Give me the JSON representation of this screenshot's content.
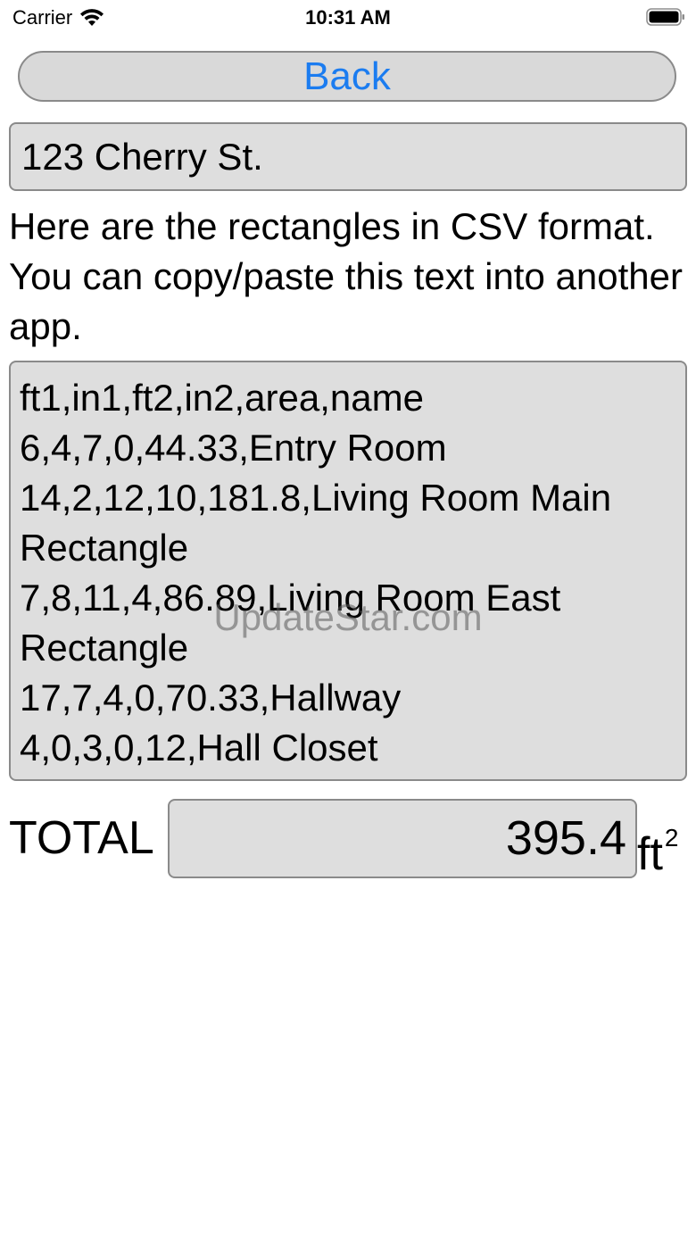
{
  "status_bar": {
    "carrier": "Carrier",
    "time": "10:31 AM",
    "wifi_icon": "wifi-icon",
    "battery_icon": "battery-icon"
  },
  "back_button": {
    "label": "Back",
    "color": "#1b7cf0"
  },
  "address_field": {
    "value": "123 Cherry St."
  },
  "instructions": "Here are the rectangles in CSV format.  You can copy/paste this text into another app.",
  "csv": {
    "lines": [
      "ft1,in1,ft2,in2,area,name",
      "6,4,7,0,44.33,Entry Room",
      "14,2,12,10,181.8,Living Room Main Rectangle",
      "7,8,11,4,86.89,Living Room East Rectangle",
      "17,7,4,0,70.33,Hallway",
      "4,0,3,0,12,Hall Closet"
    ]
  },
  "watermark": "UpdateStar.com",
  "total": {
    "label": "TOTAL",
    "value": "395.4",
    "unit": "ft",
    "unit_exponent": "2"
  }
}
